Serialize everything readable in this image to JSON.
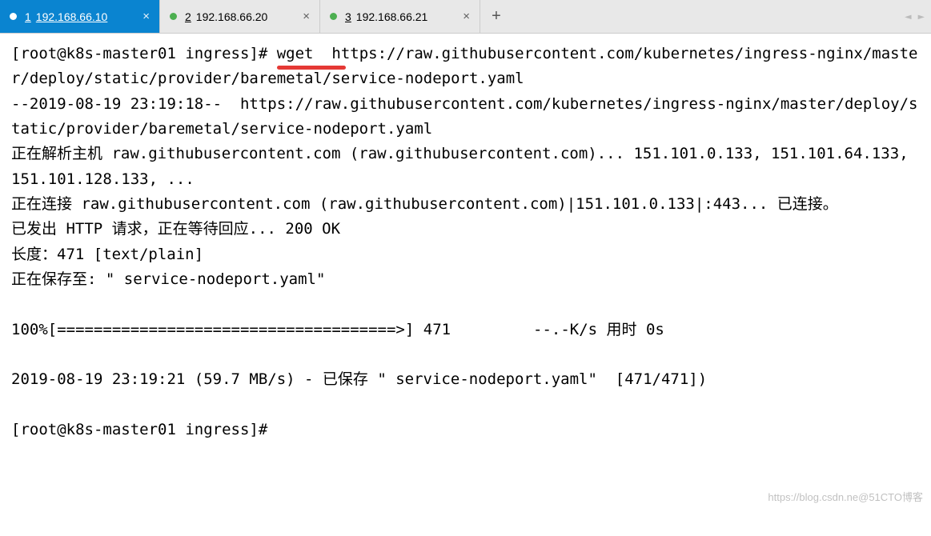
{
  "tabs": [
    {
      "num": "1",
      "label": "192.168.66.10",
      "active": true
    },
    {
      "num": "2",
      "label": "192.168.66.20",
      "active": false
    },
    {
      "num": "3",
      "label": "192.168.66.21",
      "active": false
    }
  ],
  "newTab": "+",
  "term": {
    "prompt1": "[root@k8s-master01 ingress]# ",
    "cmd_wget": "wget",
    "cmd_url": "  https://raw.githubusercontent.com/kubernetes/ingress-nginx/master/deploy/static/provider/baremetal/service-nodeport.yaml",
    "line_timestamp": "--2019-08-19 23:19:18--  https://raw.githubusercontent.com/kubernetes/ingress-nginx/master/deploy/static/provider/baremetal/service-nodeport.yaml",
    "line_resolve": "正在解析主机 raw.githubusercontent.com (raw.githubusercontent.com)... 151.101.0.133, 151.101.64.133, 151.101.128.133, ...",
    "line_connect": "正在连接 raw.githubusercontent.com (raw.githubusercontent.com)|151.101.0.133|:443... 已连接。",
    "line_http": "已发出 HTTP 请求，正在等待回应... 200 OK",
    "line_length": "长度：471 [text/plain]",
    "line_saving": "正在保存至: \" service-nodeport.yaml\"",
    "line_blank1": "",
    "line_progress": "100%[=====================================>] 471         --.-K/s 用时 0s",
    "line_blank2": "",
    "line_done": "2019-08-19 23:19:21 (59.7 MB/s) - 已保存 \" service-nodeport.yaml\"  [471/471])",
    "line_blank3": "",
    "prompt2": "[root@k8s-master01 ingress]#"
  },
  "watermark": "https://blog.csdn.ne@51CTO博客"
}
